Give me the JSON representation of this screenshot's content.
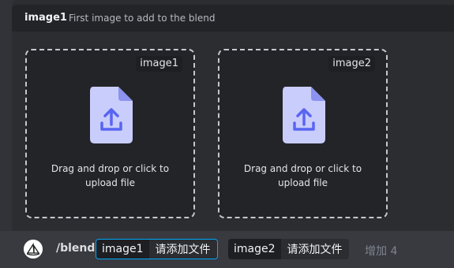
{
  "header": {
    "option_name": "image1",
    "option_description": "First image to add to the blend"
  },
  "dropzones": [
    {
      "tag": "image1",
      "text": "Drag and drop or click to upload file"
    },
    {
      "tag": "image2",
      "text": "Drag and drop or click to upload file"
    }
  ],
  "command_bar": {
    "command": "/blend",
    "options": [
      {
        "name": "image1",
        "value": "请添加文件"
      },
      {
        "name": "image2",
        "value": "请添加文件"
      }
    ],
    "more_label": "增加 4"
  },
  "icons": {
    "file": "file-upload-icon",
    "avatar": "bot-avatar-icon"
  },
  "colors": {
    "accent": "#5865f2",
    "file_icon": "#c9cdfb",
    "active_border": "#00a8fc"
  }
}
